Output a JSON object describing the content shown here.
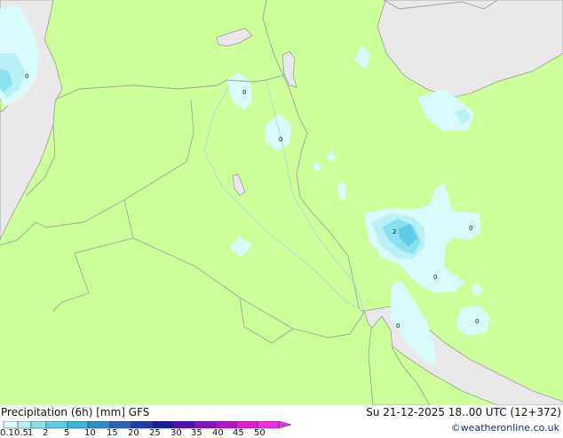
{
  "legend": {
    "title": "Precipitation (6h) [mm] GFS",
    "datetime": "Su 21-12-2025 18..00 UTC (12+372)",
    "credit": "©weatheronline.co.uk",
    "ticks": [
      "0.1",
      "0.5",
      "1",
      "2",
      "5",
      "10",
      "15",
      "20",
      "25",
      "30",
      "35",
      "40",
      "45",
      "50"
    ],
    "colors": [
      "#e0fbfb",
      "#b8f0f4",
      "#8ae2ee",
      "#5ccde6",
      "#38b4dc",
      "#2a8ecd",
      "#2a62c2",
      "#1e3ab0",
      "#1a1e9e",
      "#5010b0",
      "#8a10c4",
      "#b812d0",
      "#dc1ad8",
      "#f030e8"
    ]
  },
  "map": {
    "land_color": "#ccff99",
    "sea_color": "#e8e8e8",
    "precip_labels": [
      "0",
      "0",
      "0",
      "2",
      "0",
      "0",
      "0",
      "0"
    ]
  }
}
